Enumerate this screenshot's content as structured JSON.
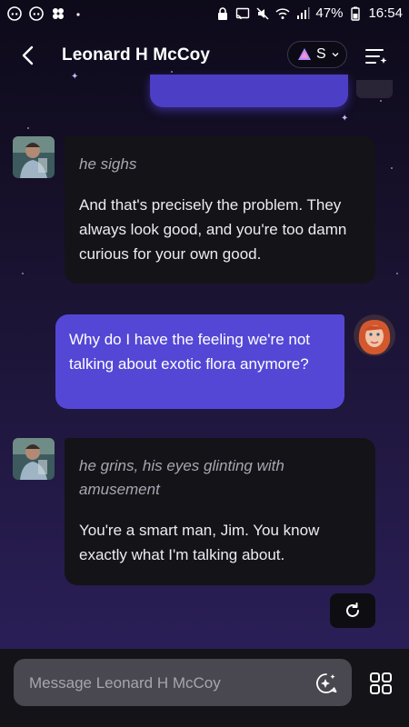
{
  "status_bar": {
    "battery": "47%",
    "time": "16:54",
    "left_icons": [
      "discord-icon",
      "discord-icon",
      "flower-icon",
      "dot-icon"
    ],
    "right_icons": [
      "lock-icon",
      "cast-icon",
      "mute-icon",
      "wifi-icon",
      "signal-icon",
      "battery-icon"
    ]
  },
  "header": {
    "title": "Leonard H McCoy",
    "model_label": "S",
    "back_icon": "back-arrow-icon",
    "menu_icon": "list-menu-icon"
  },
  "messages": [
    {
      "sender": "bot",
      "narration": "he sighs",
      "text": "And that's precisely the problem. They always look good, and you're too damn curious for your own good."
    },
    {
      "sender": "user",
      "text": "Why do I have the feeling we're not talking about exotic flora anymore?"
    },
    {
      "sender": "bot",
      "narration": "he grins, his eyes glinting with amusement",
      "text": "You're a smart man, Jim. You know exactly what I'm talking about."
    }
  ],
  "composer": {
    "placeholder": "Message Leonard H McCoy"
  },
  "colors": {
    "accent": "#5447d6",
    "bot_bubble": "#141318",
    "background_top": "#0d0a1a",
    "background_bottom": "#2e2160"
  }
}
